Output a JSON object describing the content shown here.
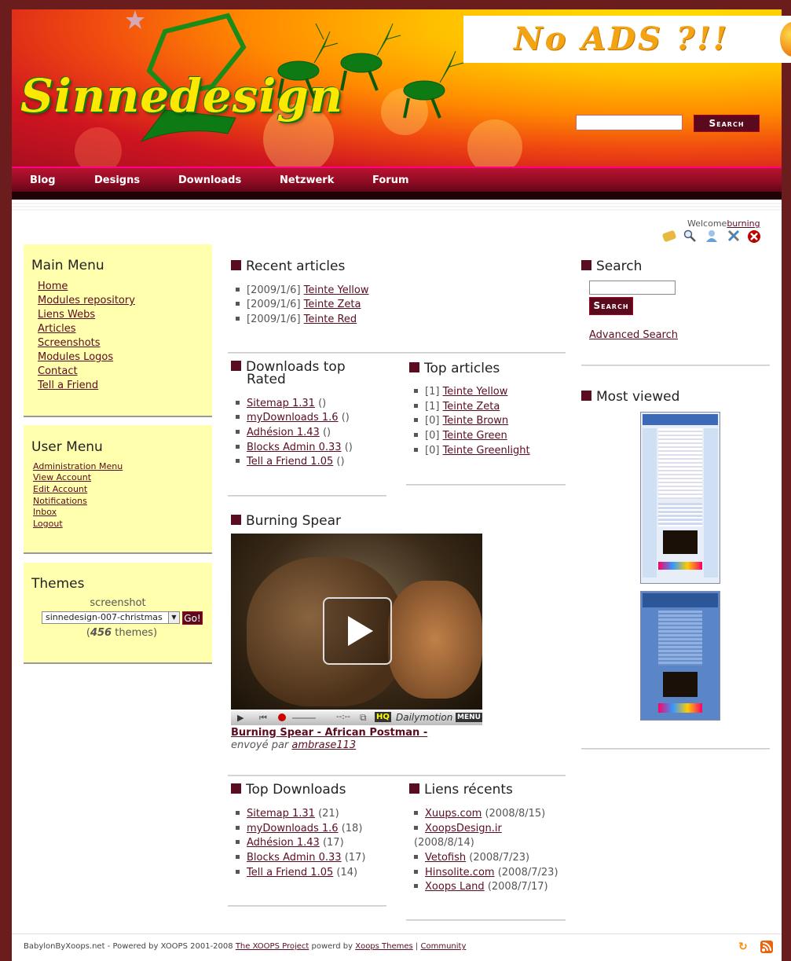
{
  "brand": {
    "logo_text": "Sinnedesign",
    "ad_text": "No ADS ?!!"
  },
  "header_search": {
    "button_label": "Search",
    "value": ""
  },
  "nav": [
    "Blog",
    "Designs",
    "Downloads",
    "Netzwerk",
    "Forum"
  ],
  "welcome": {
    "prefix": "Welcome",
    "user": "burning"
  },
  "main_menu": {
    "title": "Main Menu",
    "items": [
      "Home",
      "Modules repository",
      "Liens Webs",
      "Articles",
      "Screenshots",
      "Modules Logos",
      "Contact",
      "Tell a Friend"
    ]
  },
  "user_menu": {
    "title": "User Menu",
    "items": [
      "Administration Menu",
      "View Account",
      "Edit Account",
      "Notifications",
      "Inbox",
      "Logout"
    ]
  },
  "themes": {
    "title": "Themes",
    "caption": "screenshot",
    "selected": "sinnedesign-007-christmas",
    "go_label": "Go!",
    "count_pre": "(",
    "count": "456",
    "count_post": " themes)"
  },
  "recent_articles": {
    "title": "Recent articles",
    "items": [
      {
        "date": "[2009/1/6]",
        "label": "Teinte Yellow"
      },
      {
        "date": "[2009/1/6]",
        "label": "Teinte Zeta"
      },
      {
        "date": "[2009/1/6]",
        "label": "Teinte Red"
      }
    ]
  },
  "downloads_top_rated": {
    "title_line1": "Downloads top",
    "title_line2": "Rated",
    "items": [
      {
        "label": "Sitemap 1.31",
        "extra": "()"
      },
      {
        "label": "myDownloads 1.6",
        "extra": "()"
      },
      {
        "label": "Adhésion 1.43",
        "extra": "()"
      },
      {
        "label": "Blocks Admin 0.33",
        "extra": "()"
      },
      {
        "label": "Tell a Friend 1.05",
        "extra": "()"
      }
    ]
  },
  "top_articles": {
    "title": "Top articles",
    "items": [
      {
        "count": "[1]",
        "label": "Teinte Yellow"
      },
      {
        "count": "[1]",
        "label": "Teinte Zeta"
      },
      {
        "count": "[0]",
        "label": "Teinte Brown"
      },
      {
        "count": "[0]",
        "label": "Teinte Green"
      },
      {
        "count": "[0]",
        "label": "Teinte Greenlight"
      }
    ]
  },
  "burning_spear": {
    "title": "Burning Spear",
    "video_link": "Burning Spear - African Postman -",
    "sent_by_prefix": "envoyé par ",
    "sent_by_user": "ambrase113",
    "player_brand": "Dailymotion",
    "player_hq": "HQ",
    "player_menu": "MENU",
    "player_time": "--:--"
  },
  "top_downloads": {
    "title": "Top Downloads",
    "items": [
      {
        "label": "Sitemap 1.31",
        "extra": "(21)"
      },
      {
        "label": "myDownloads 1.6",
        "extra": "(18)"
      },
      {
        "label": "Adhésion 1.43",
        "extra": "(17)"
      },
      {
        "label": "Blocks Admin 0.33",
        "extra": "(17)"
      },
      {
        "label": "Tell a Friend 1.05",
        "extra": "(14)"
      }
    ]
  },
  "liens_recents": {
    "title": "Liens récents",
    "items": [
      {
        "label": "Xuups.com",
        "date": "(2008/8/15)"
      },
      {
        "label": "XoopsDesign.ir",
        "date": "(2008/8/14)"
      },
      {
        "label": "Vetofish",
        "date": "(2008/7/23)"
      },
      {
        "label": "Hinsolite.com",
        "date": "(2008/7/23)"
      },
      {
        "label": "Xoops Land",
        "date": "(2008/7/17)"
      }
    ]
  },
  "right_search": {
    "title": "Search",
    "button_label": "Search",
    "advanced": "Advanced Search"
  },
  "most_viewed": {
    "title": "Most viewed"
  },
  "footer": {
    "text_pre": "BabylonByXoops.net - Powered by XOOPS 2001-2008 ",
    "link1": "The XOOPS Project",
    "text_mid": " powerd by ",
    "link2": "Xoops Themes",
    "sep": " | ",
    "link3": "Community"
  },
  "colors": {
    "accent": "#5a0d20",
    "panel": "#ffffae",
    "nav": "#8a0b22"
  }
}
